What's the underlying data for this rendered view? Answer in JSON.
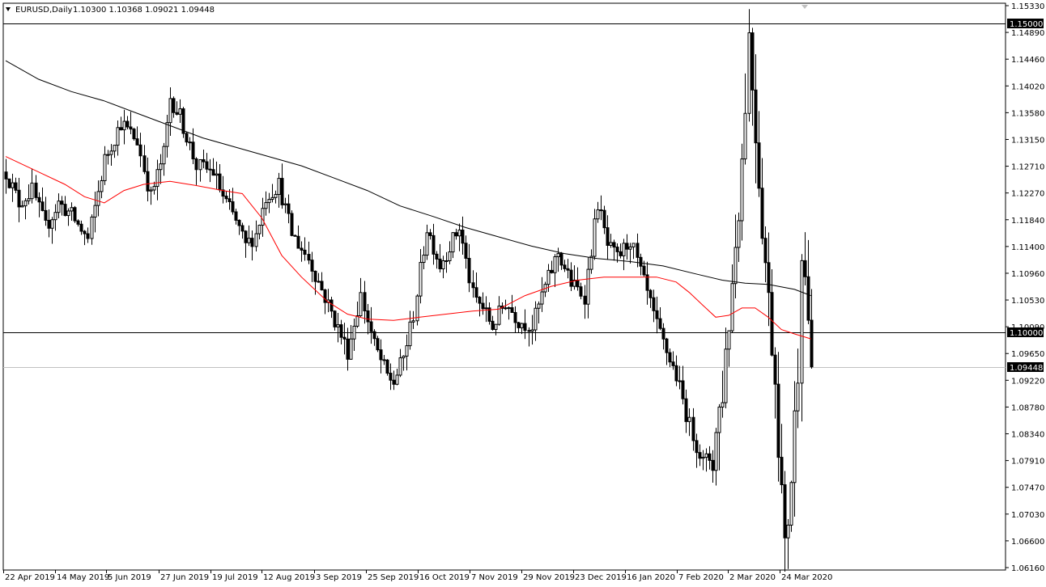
{
  "header": {
    "symbol_timeframe": "EURUSD,Daily",
    "ohlc": "1.10300 1.10368 1.09021 1.09448"
  },
  "colors": {
    "background": "#ffffff",
    "candle": "#000000",
    "ma_fast": "#ff0000",
    "ma_slow": "#000000",
    "level_line": "#000000",
    "bid_line": "#c0c0c0",
    "price_tag_bg": "#000000",
    "price_tag_text": "#ffffff"
  },
  "chart_data": {
    "type": "candlestick",
    "ylim": [
      1.0616,
      1.1533
    ],
    "y_ticks": [
      "1.15330",
      "1.14890",
      "1.14460",
      "1.14020",
      "1.13580",
      "1.13150",
      "1.12710",
      "1.12270",
      "1.11840",
      "1.11400",
      "1.10960",
      "1.10530",
      "1.10090",
      "1.09650",
      "1.09220",
      "1.08780",
      "1.08340",
      "1.07910",
      "1.07470",
      "1.07030",
      "1.06600",
      "1.06160"
    ],
    "x_ticks": [
      "22 Apr 2019",
      "14 May 2019",
      "5 Jun 2019",
      "27 Jun 2019",
      "19 Jul 2019",
      "12 Aug 2019",
      "3 Sep 2019",
      "25 Sep 2019",
      "16 Oct 2019",
      "7 Nov 2019",
      "29 Nov 2019",
      "23 Dec 2019",
      "16 Jan 2020",
      "7 Feb 2020",
      "2 Mar 2020",
      "24 Mar 2020"
    ],
    "horizontal_levels": [
      {
        "price": 1.15,
        "label": "1.15000"
      },
      {
        "price": 1.1,
        "label": "1.10000"
      }
    ],
    "current_price": {
      "price": 1.09448,
      "label": "1.09448"
    },
    "bar_count": 245,
    "close_path": [
      [
        0,
        1.126
      ],
      [
        4,
        1.121
      ],
      [
        8,
        1.123
      ],
      [
        12,
        1.117
      ],
      [
        16,
        1.121
      ],
      [
        20,
        1.119
      ],
      [
        25,
        1.115
      ],
      [
        30,
        1.128
      ],
      [
        35,
        1.134
      ],
      [
        40,
        1.131
      ],
      [
        44,
        1.122
      ],
      [
        48,
        1.129
      ],
      [
        50,
        1.138
      ],
      [
        53,
        1.135
      ],
      [
        58,
        1.127
      ],
      [
        63,
        1.126
      ],
      [
        66,
        1.122
      ],
      [
        70,
        1.118
      ],
      [
        73,
        1.114
      ],
      [
        76,
        1.116
      ],
      [
        79,
        1.122
      ],
      [
        83,
        1.124
      ],
      [
        87,
        1.116
      ],
      [
        92,
        1.112
      ],
      [
        96,
        1.107
      ],
      [
        100,
        1.102
      ],
      [
        104,
        1.097
      ],
      [
        108,
        1.106
      ],
      [
        112,
        1.098
      ],
      [
        116,
        1.093
      ],
      [
        118,
        1.092
      ],
      [
        121,
        1.096
      ],
      [
        124,
        1.103
      ],
      [
        128,
        1.117
      ],
      [
        132,
        1.111
      ],
      [
        138,
        1.117
      ],
      [
        142,
        1.106
      ],
      [
        145,
        1.104
      ],
      [
        148,
        1.101
      ],
      [
        152,
        1.105
      ],
      [
        156,
        1.102
      ],
      [
        160,
        1.101
      ],
      [
        163,
        1.106
      ],
      [
        168,
        1.113
      ],
      [
        172,
        1.108
      ],
      [
        176,
        1.106
      ],
      [
        180,
        1.121
      ],
      [
        183,
        1.114
      ],
      [
        186,
        1.112
      ],
      [
        190,
        1.115
      ],
      [
        194,
        1.108
      ],
      [
        198,
        1.101
      ],
      [
        201,
        1.097
      ],
      [
        204,
        1.093
      ],
      [
        208,
        1.085
      ],
      [
        212,
        1.079
      ],
      [
        215,
        1.08
      ],
      [
        218,
        1.091
      ],
      [
        221,
        1.108
      ],
      [
        224,
        1.128
      ],
      [
        226,
        1.148
      ],
      [
        228,
        1.133
      ],
      [
        230,
        1.118
      ],
      [
        232,
        1.105
      ],
      [
        234,
        1.093
      ],
      [
        236,
        1.074
      ],
      [
        237,
        1.064
      ],
      [
        239,
        1.077
      ],
      [
        241,
        1.095
      ],
      [
        242,
        1.115
      ],
      [
        244,
        1.103
      ],
      [
        245,
        1.0945
      ]
    ],
    "series": [
      {
        "name": "",
        "type": "moving_average",
        "color": "red",
        "points": [
          [
            0,
            1.1285
          ],
          [
            10,
            1.126
          ],
          [
            18,
            1.124
          ],
          [
            24,
            1.122
          ],
          [
            30,
            1.121
          ],
          [
            36,
            1.123
          ],
          [
            42,
            1.124
          ],
          [
            50,
            1.1245
          ],
          [
            58,
            1.1238
          ],
          [
            66,
            1.123
          ],
          [
            72,
            1.1225
          ],
          [
            78,
            1.1185
          ],
          [
            84,
            1.1125
          ],
          [
            90,
            1.109
          ],
          [
            98,
            1.105
          ],
          [
            104,
            1.103
          ],
          [
            110,
            1.1022
          ],
          [
            118,
            1.102
          ],
          [
            126,
            1.1025
          ],
          [
            134,
            1.103
          ],
          [
            142,
            1.1035
          ],
          [
            150,
            1.1038
          ],
          [
            158,
            1.106
          ],
          [
            166,
            1.1075
          ],
          [
            174,
            1.1085
          ],
          [
            182,
            1.109
          ],
          [
            190,
            1.109
          ],
          [
            198,
            1.109
          ],
          [
            204,
            1.1082
          ],
          [
            208,
            1.1065
          ],
          [
            212,
            1.1045
          ],
          [
            216,
            1.1025
          ],
          [
            220,
            1.1028
          ],
          [
            224,
            1.104
          ],
          [
            228,
            1.104
          ],
          [
            232,
            1.1025
          ],
          [
            236,
            1.1005
          ],
          [
            240,
            1.0998
          ],
          [
            245,
            1.099
          ]
        ]
      },
      {
        "name": "",
        "type": "moving_average",
        "color": "black",
        "points": [
          [
            0,
            1.144
          ],
          [
            10,
            1.141
          ],
          [
            20,
            1.139
          ],
          [
            30,
            1.1375
          ],
          [
            40,
            1.1355
          ],
          [
            50,
            1.1335
          ],
          [
            60,
            1.1315
          ],
          [
            70,
            1.13
          ],
          [
            80,
            1.1285
          ],
          [
            90,
            1.127
          ],
          [
            100,
            1.125
          ],
          [
            110,
            1.123
          ],
          [
            120,
            1.1205
          ],
          [
            130,
            1.1188
          ],
          [
            140,
            1.117
          ],
          [
            150,
            1.1155
          ],
          [
            160,
            1.114
          ],
          [
            170,
            1.1128
          ],
          [
            180,
            1.112
          ],
          [
            190,
            1.1115
          ],
          [
            200,
            1.1108
          ],
          [
            210,
            1.1095
          ],
          [
            218,
            1.1085
          ],
          [
            225,
            1.108
          ],
          [
            232,
            1.1078
          ],
          [
            240,
            1.107
          ],
          [
            245,
            1.106
          ]
        ]
      }
    ]
  }
}
